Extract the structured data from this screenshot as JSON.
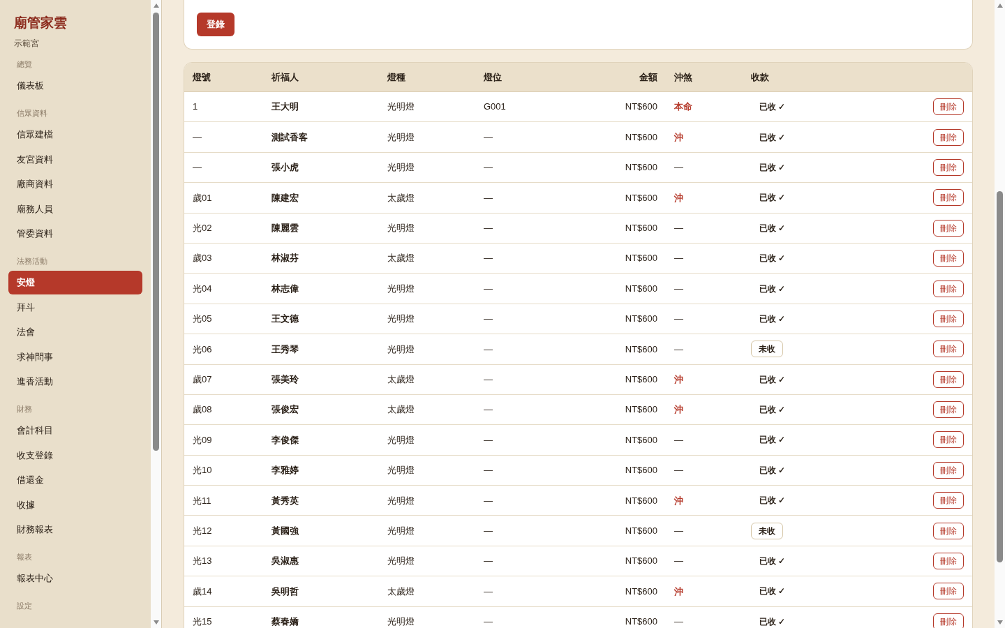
{
  "sidebar": {
    "title": "廟管家雲",
    "subtitle": "示範宮",
    "sections": [
      {
        "label": "總覽",
        "items": [
          {
            "label": "儀表板",
            "selected": false
          }
        ]
      },
      {
        "label": "信眾資料",
        "items": [
          {
            "label": "信眾建檔",
            "selected": false
          },
          {
            "label": "友宮資料",
            "selected": false
          },
          {
            "label": "廠商資料",
            "selected": false
          },
          {
            "label": "廟務人員",
            "selected": false
          },
          {
            "label": "管委資料",
            "selected": false
          }
        ]
      },
      {
        "label": "法務活動",
        "items": [
          {
            "label": "安燈",
            "selected": true
          },
          {
            "label": "拜斗",
            "selected": false
          },
          {
            "label": "法會",
            "selected": false
          },
          {
            "label": "求神問事",
            "selected": false
          },
          {
            "label": "進香活動",
            "selected": false
          }
        ]
      },
      {
        "label": "財務",
        "items": [
          {
            "label": "會計科目",
            "selected": false
          },
          {
            "label": "收支登錄",
            "selected": false
          },
          {
            "label": "借還金",
            "selected": false
          },
          {
            "label": "收據",
            "selected": false
          },
          {
            "label": "財務報表",
            "selected": false
          }
        ]
      },
      {
        "label": "報表",
        "items": [
          {
            "label": "報表中心",
            "selected": false
          }
        ]
      },
      {
        "label": "設定"
      }
    ]
  },
  "form": {
    "submit_button": "登錄"
  },
  "table": {
    "columns": [
      "燈號",
      "祈福人",
      "燈種",
      "燈位",
      "金額",
      "沖煞",
      "收款"
    ],
    "rows": [
      {
        "number": "1",
        "name": "王大明",
        "type": "光明燈",
        "position": "G001",
        "amount": "NT$600",
        "clash": "本命",
        "clash_alert": true,
        "payment": "已收 ✓",
        "paid": true,
        "action": "刪除"
      },
      {
        "number": "—",
        "name": "測試香客",
        "type": "光明燈",
        "position": "—",
        "amount": "NT$600",
        "clash": "沖",
        "clash_alert": true,
        "payment": "已收 ✓",
        "paid": true,
        "action": "刪除"
      },
      {
        "number": "—",
        "name": "張小虎",
        "type": "光明燈",
        "position": "—",
        "amount": "NT$600",
        "clash": "—",
        "clash_alert": false,
        "payment": "已收 ✓",
        "paid": true,
        "action": "刪除"
      },
      {
        "number": "歲01",
        "name": "陳建宏",
        "type": "太歲燈",
        "position": "—",
        "amount": "NT$600",
        "clash": "沖",
        "clash_alert": true,
        "payment": "已收 ✓",
        "paid": true,
        "action": "刪除"
      },
      {
        "number": "光02",
        "name": "陳麗雲",
        "type": "光明燈",
        "position": "—",
        "amount": "NT$600",
        "clash": "—",
        "clash_alert": false,
        "payment": "已收 ✓",
        "paid": true,
        "action": "刪除"
      },
      {
        "number": "歲03",
        "name": "林淑芬",
        "type": "太歲燈",
        "position": "—",
        "amount": "NT$600",
        "clash": "—",
        "clash_alert": false,
        "payment": "已收 ✓",
        "paid": true,
        "action": "刪除"
      },
      {
        "number": "光04",
        "name": "林志偉",
        "type": "光明燈",
        "position": "—",
        "amount": "NT$600",
        "clash": "—",
        "clash_alert": false,
        "payment": "已收 ✓",
        "paid": true,
        "action": "刪除"
      },
      {
        "number": "光05",
        "name": "王文德",
        "type": "光明燈",
        "position": "—",
        "amount": "NT$600",
        "clash": "—",
        "clash_alert": false,
        "payment": "已收 ✓",
        "paid": true,
        "action": "刪除"
      },
      {
        "number": "光06",
        "name": "王秀琴",
        "type": "光明燈",
        "position": "—",
        "amount": "NT$600",
        "clash": "—",
        "clash_alert": false,
        "payment": "未收",
        "paid": false,
        "action": "刪除"
      },
      {
        "number": "歲07",
        "name": "張美玲",
        "type": "太歲燈",
        "position": "—",
        "amount": "NT$600",
        "clash": "沖",
        "clash_alert": true,
        "payment": "已收 ✓",
        "paid": true,
        "action": "刪除"
      },
      {
        "number": "歲08",
        "name": "張俊宏",
        "type": "太歲燈",
        "position": "—",
        "amount": "NT$600",
        "clash": "沖",
        "clash_alert": true,
        "payment": "已收 ✓",
        "paid": true,
        "action": "刪除"
      },
      {
        "number": "光09",
        "name": "李俊傑",
        "type": "光明燈",
        "position": "—",
        "amount": "NT$600",
        "clash": "—",
        "clash_alert": false,
        "payment": "已收 ✓",
        "paid": true,
        "action": "刪除"
      },
      {
        "number": "光10",
        "name": "李雅婷",
        "type": "光明燈",
        "position": "—",
        "amount": "NT$600",
        "clash": "—",
        "clash_alert": false,
        "payment": "已收 ✓",
        "paid": true,
        "action": "刪除"
      },
      {
        "number": "光11",
        "name": "黃秀英",
        "type": "光明燈",
        "position": "—",
        "amount": "NT$600",
        "clash": "沖",
        "clash_alert": true,
        "payment": "已收 ✓",
        "paid": true,
        "action": "刪除"
      },
      {
        "number": "光12",
        "name": "黃國強",
        "type": "光明燈",
        "position": "—",
        "amount": "NT$600",
        "clash": "—",
        "clash_alert": false,
        "payment": "未收",
        "paid": false,
        "action": "刪除"
      },
      {
        "number": "光13",
        "name": "吳淑惠",
        "type": "光明燈",
        "position": "—",
        "amount": "NT$600",
        "clash": "—",
        "clash_alert": false,
        "payment": "已收 ✓",
        "paid": true,
        "action": "刪除"
      },
      {
        "number": "歲14",
        "name": "吳明哲",
        "type": "太歲燈",
        "position": "—",
        "amount": "NT$600",
        "clash": "沖",
        "clash_alert": true,
        "payment": "已收 ✓",
        "paid": true,
        "action": "刪除"
      },
      {
        "number": "光15",
        "name": "蔡春嬌",
        "type": "光明燈",
        "position": "—",
        "amount": "NT$600",
        "clash": "—",
        "clash_alert": false,
        "payment": "已收 ✓",
        "paid": true,
        "action": "刪除"
      }
    ]
  }
}
